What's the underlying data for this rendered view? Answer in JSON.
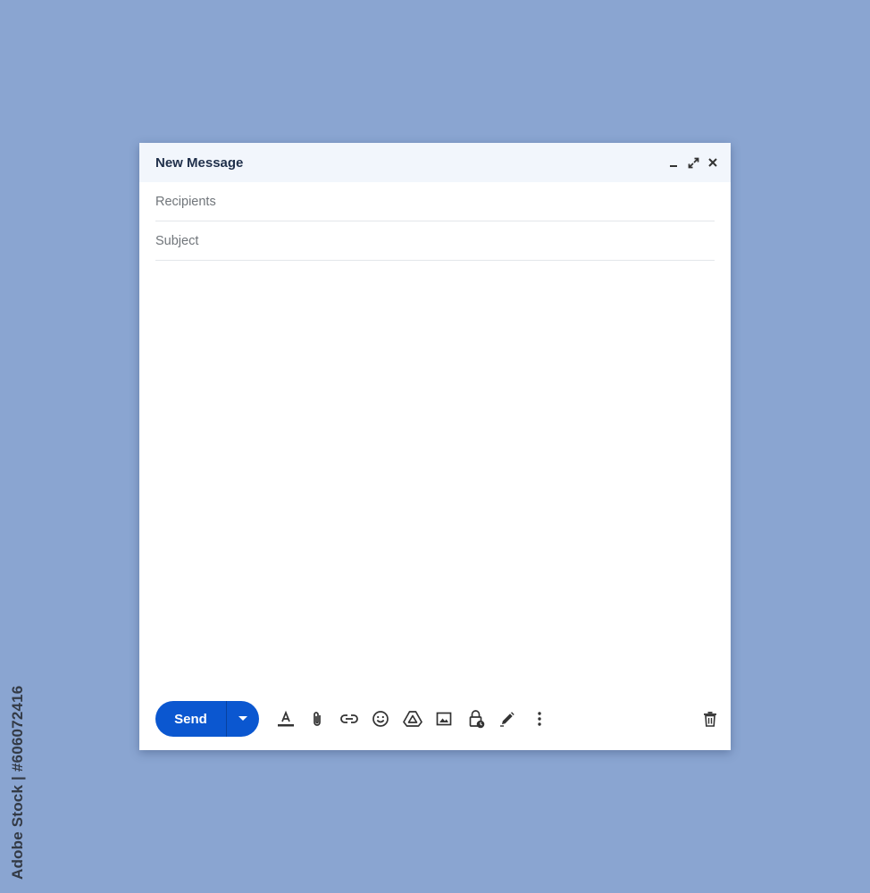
{
  "compose": {
    "title": "New Message",
    "window_controls": [
      "minimize-icon",
      "expand-icon",
      "close-icon"
    ],
    "recipients": {
      "placeholder": "Recipients",
      "value": ""
    },
    "subject": {
      "placeholder": "Subject",
      "value": ""
    },
    "body": {
      "value": ""
    }
  },
  "toolbar": {
    "send_label": "Send",
    "send_options_icon": "caret-down-icon",
    "tools": [
      "text-format-icon",
      "attach-icon",
      "link-icon",
      "emoji-icon",
      "drive-icon",
      "image-icon",
      "confidential-lock-icon",
      "signature-pen-icon",
      "more-options-icon"
    ],
    "discard_icon": "trash-icon"
  },
  "colors": {
    "background": "#8aa5d1",
    "titlebar": "#f2f6fc",
    "send_button": "#0b57d0",
    "title_text": "#1f2f4a"
  },
  "watermark": {
    "text": "Adobe Stock | #606072416"
  }
}
